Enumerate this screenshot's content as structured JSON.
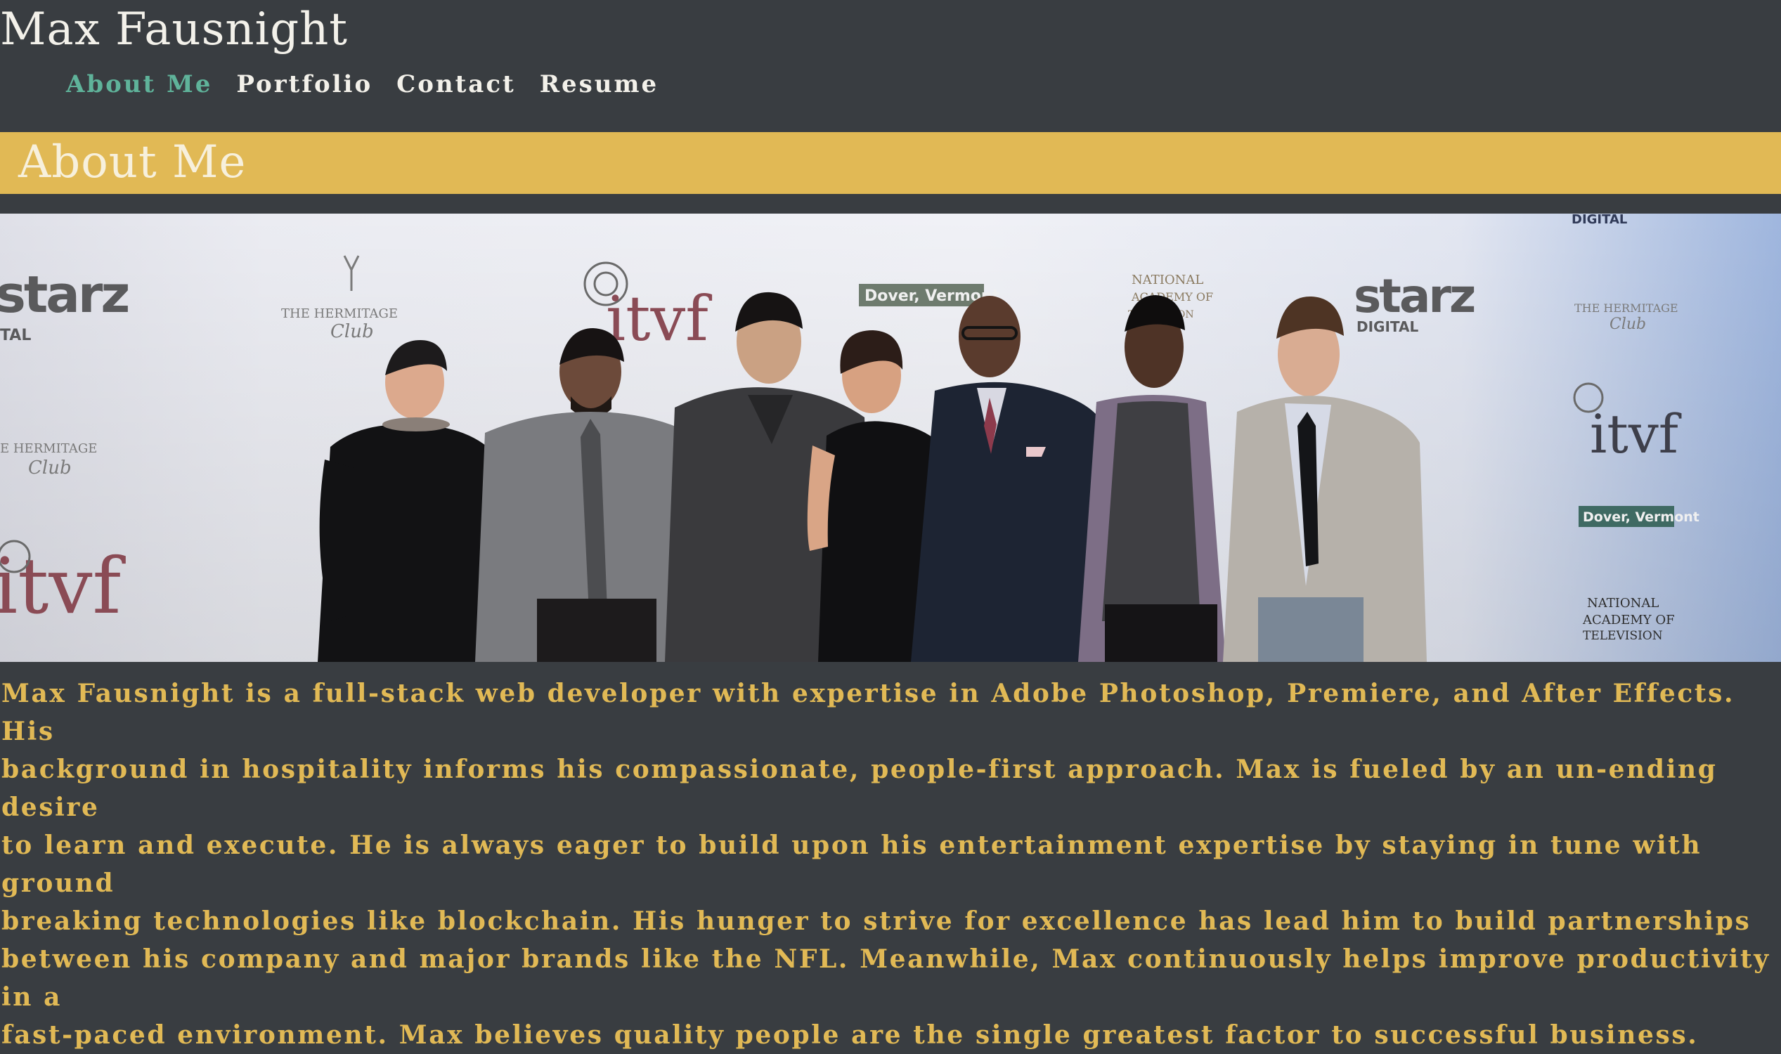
{
  "site": {
    "title": "Max Fausnight",
    "accent_color": "#5fb39a",
    "banner_color": "#e1b955",
    "background_color": "#393d41"
  },
  "nav": {
    "items": [
      {
        "label": "About Me",
        "active": true
      },
      {
        "label": "Portfolio",
        "active": false
      },
      {
        "label": "Contact",
        "active": false
      },
      {
        "label": "Resume",
        "active": false
      }
    ]
  },
  "section": {
    "title": "About Me"
  },
  "hero": {
    "backdrop_logos": [
      "starz",
      "itvf",
      "Dover, Vermont",
      "THE HERMITAGE Club",
      "NATIONAL ACADEMY OF TELEVISION",
      "DIGITAL"
    ]
  },
  "bio": {
    "text": "Max Fausnight is a full-stack web developer with expertise in Adobe Photoshop, Premiere, and After Effects. His\nbackground in hospitality informs his compassionate, people-first approach. Max is fueled by an un-ending desire\nto learn and execute. He is always eager to build upon his entertainment expertise by staying in tune with ground\nbreaking technologies like blockchain. His hunger to strive for excellence has lead him to build partnerships\nbetween his company and major brands like the NFL. Meanwhile, Max continuously helps improve productivity in a\nfast-paced environment. Max believes quality people are the single greatest factor to successful business."
  }
}
